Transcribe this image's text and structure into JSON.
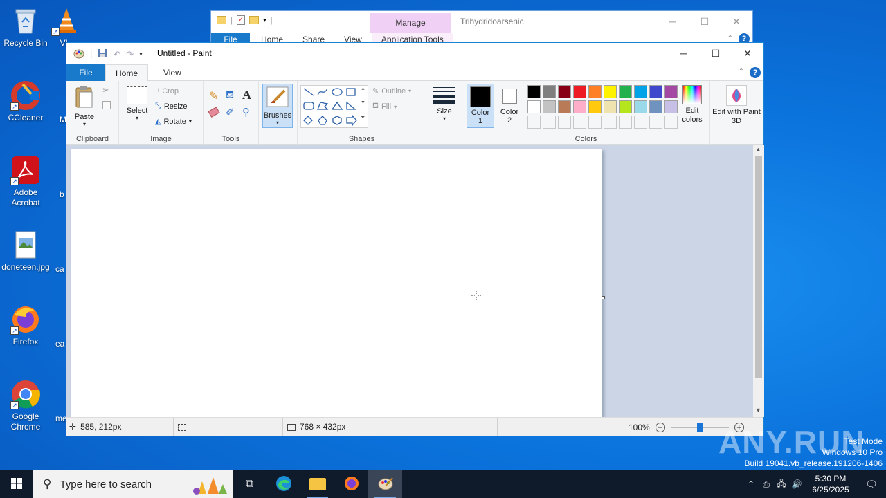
{
  "desktop": {
    "icons": [
      {
        "label": "Recycle Bin",
        "icon": "recycle-bin-icon"
      },
      {
        "label": "VL",
        "icon": "vlc-icon"
      },
      {
        "label": "CCleaner",
        "icon": "ccleaner-icon"
      },
      {
        "label": "M",
        "icon": "partial-icon"
      },
      {
        "label": "Adobe Acrobat",
        "icon": "acrobat-icon"
      },
      {
        "label": "b",
        "icon": "partial-icon"
      },
      {
        "label": "doneteen.jpg",
        "icon": "image-file-icon"
      },
      {
        "label": "ca",
        "icon": "partial-icon"
      },
      {
        "label": "Firefox",
        "icon": "firefox-icon"
      },
      {
        "label": "ea",
        "icon": "partial-icon"
      },
      {
        "label": "Google Chrome",
        "icon": "chrome-icon"
      },
      {
        "label": "me",
        "icon": "partial-icon"
      }
    ]
  },
  "explorer": {
    "manage_label": "Manage",
    "title": "Trihydridoarsenic",
    "tabs": [
      "File",
      "Home",
      "Share",
      "View",
      "Application Tools"
    ],
    "minimize": "─",
    "maximize": "☐",
    "close": "✕"
  },
  "paint": {
    "title": "Untitled - Paint",
    "tabs": {
      "file": "File",
      "home": "Home",
      "view": "View"
    },
    "clipboard": {
      "paste": "Paste",
      "label": "Clipboard"
    },
    "image": {
      "select": "Select",
      "crop": "Crop",
      "resize": "Resize",
      "rotate": "Rotate",
      "label": "Image"
    },
    "tools": {
      "label": "Tools"
    },
    "brushes": {
      "label": "Brushes"
    },
    "shapes": {
      "outline": "Outline",
      "fill": "Fill",
      "label": "Shapes"
    },
    "size": {
      "label": "Size"
    },
    "colors": {
      "color1_label": "Color",
      "color1_num": "1",
      "color2_label": "Color",
      "color2_num": "2",
      "edit_colors": "Edit colors",
      "edit_paint3d": "Edit with Paint 3D",
      "label": "Colors",
      "color1": "#000000",
      "color2": "#ffffff",
      "palette_row1": [
        "#000000",
        "#7f7f7f",
        "#880015",
        "#ed1c24",
        "#ff7f27",
        "#fff200",
        "#22b14c",
        "#00a2e8",
        "#3f48cc",
        "#a349a4"
      ],
      "palette_row2": [
        "#ffffff",
        "#c3c3c3",
        "#b97a57",
        "#ffaec9",
        "#ffc90e",
        "#efe4b0",
        "#b5e61d",
        "#99d9ea",
        "#7092be",
        "#c8bfe7"
      ]
    },
    "status": {
      "cursor_pos": "585, 212px",
      "canvas_size": "768 × 432px",
      "zoom": "100%"
    }
  },
  "taskbar": {
    "search_placeholder": "Type here to search",
    "time": "5:30 PM",
    "date": "6/25/2025"
  },
  "watermark": {
    "line1": "Test Mode",
    "line2": "Windows 10 Pro",
    "line3": "Build 19041.vb_release.191206-1406",
    "anyrun": "ANY.RUN"
  }
}
